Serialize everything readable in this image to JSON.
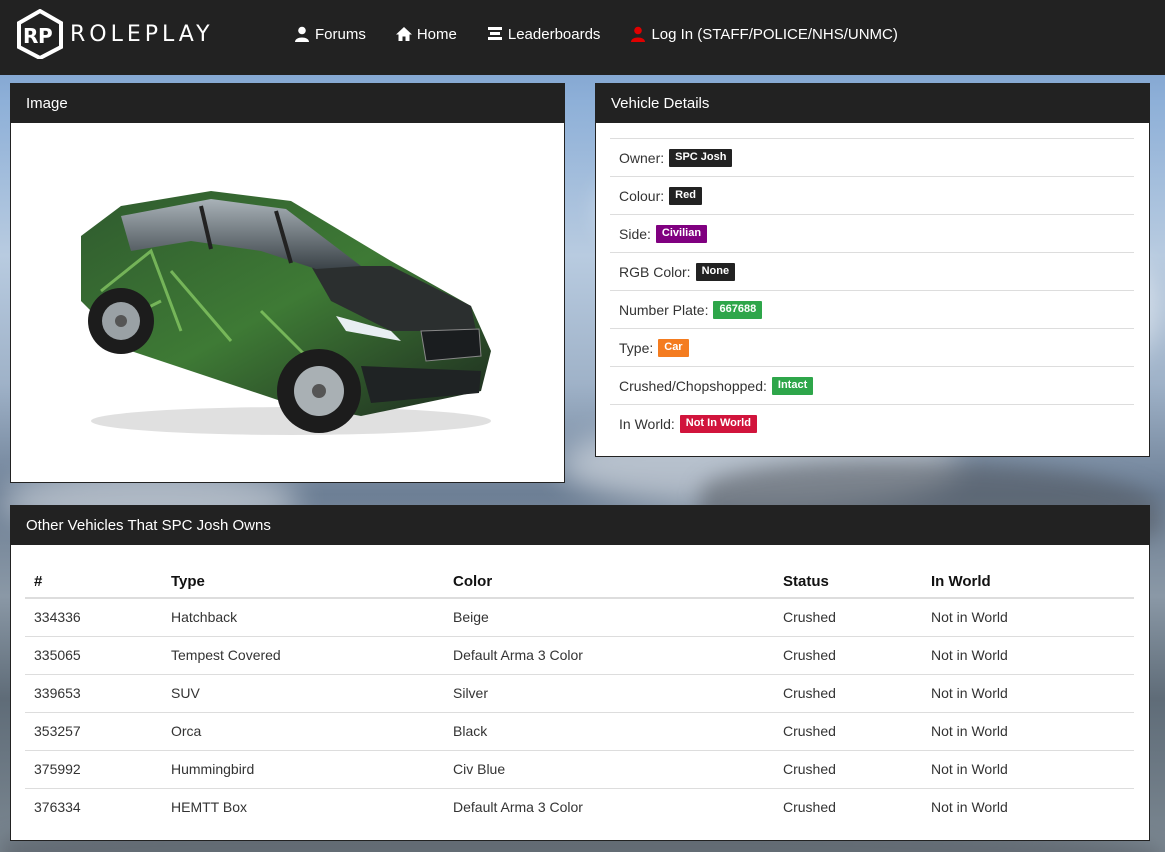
{
  "brand": {
    "name": "ROLEPLAY",
    "logo_icon": "rp-logo-icon"
  },
  "nav": [
    {
      "label": "Forums",
      "icon": "user-icon",
      "color": "#ffffff"
    },
    {
      "label": "Home",
      "icon": "home-icon",
      "color": "#ffffff"
    },
    {
      "label": "Leaderboards",
      "icon": "list-icon",
      "color": "#ffffff"
    },
    {
      "label": "Log In (STAFF/POLICE/NHS/UNMC)",
      "icon": "user-icon",
      "color": "#e00000"
    }
  ],
  "image_panel": {
    "title": "Image"
  },
  "details_panel": {
    "title": "Vehicle Details",
    "rows": [
      {
        "label": "Owner:",
        "value": "SPC Josh",
        "color": "#222222"
      },
      {
        "label": "Colour:",
        "value": "Red",
        "color": "#222222"
      },
      {
        "label": "Side:",
        "value": "Civilian",
        "color": "#800080"
      },
      {
        "label": "RGB Color:",
        "value": "None",
        "color": "#222222"
      },
      {
        "label": "Number Plate:",
        "value": "667688",
        "color": "#2ea64a"
      },
      {
        "label": "Type:",
        "value": "Car",
        "color": "#f47c20"
      },
      {
        "label": "Crushed/Chopshopped:",
        "value": "Intact",
        "color": "#2ea64a"
      },
      {
        "label": "In World:",
        "value": "Not In World",
        "color": "#d1143c"
      }
    ]
  },
  "vehicles_panel": {
    "title": "Other Vehicles That SPC Josh Owns",
    "columns": [
      "#",
      "Type",
      "Color",
      "Status",
      "In World"
    ],
    "rows": [
      [
        "334336",
        "Hatchback",
        "Beige",
        "Crushed",
        "Not in World"
      ],
      [
        "335065",
        "Tempest Covered",
        "Default Arma 3 Color",
        "Crushed",
        "Not in World"
      ],
      [
        "339653",
        "SUV",
        "Silver",
        "Crushed",
        "Not in World"
      ],
      [
        "353257",
        "Orca",
        "Black",
        "Crushed",
        "Not in World"
      ],
      [
        "375992",
        "Hummingbird",
        "Civ Blue",
        "Crushed",
        "Not in World"
      ],
      [
        "376334",
        "HEMTT Box",
        "Default Arma 3 Color",
        "Crushed",
        "Not in World"
      ]
    ]
  }
}
